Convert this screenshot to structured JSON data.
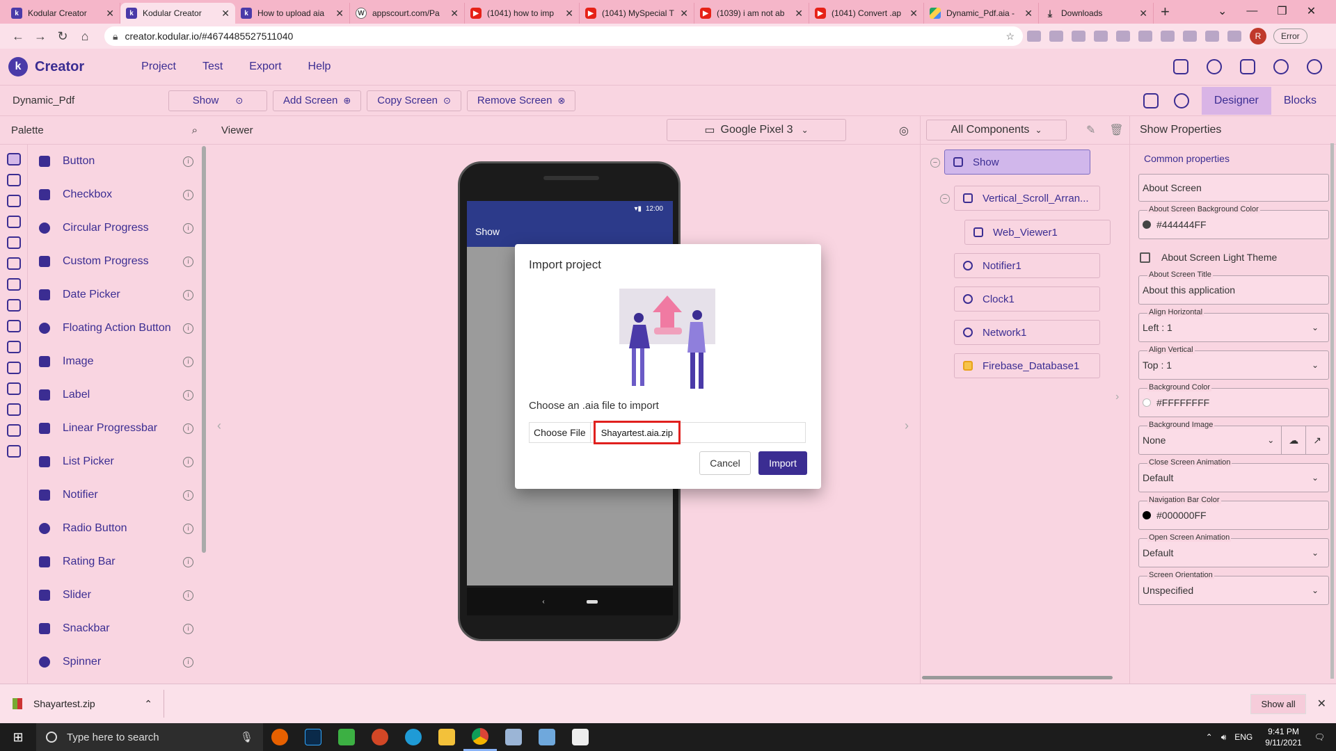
{
  "browser": {
    "tabs": [
      {
        "title": "Kodular Creator",
        "icon": "kodular-icon",
        "active": false
      },
      {
        "title": "Kodular Creator",
        "icon": "kodular-icon",
        "active": true
      },
      {
        "title": "How to upload aia",
        "icon": "kodular-icon",
        "active": false
      },
      {
        "title": "appscourt.com/Pa",
        "icon": "wordpress-icon",
        "active": false
      },
      {
        "title": "(1041) how to imp",
        "icon": "youtube-icon",
        "active": false
      },
      {
        "title": "(1041) MySpecial T",
        "icon": "youtube-icon",
        "active": false
      },
      {
        "title": "(1039) i am not ab",
        "icon": "youtube-icon",
        "active": false
      },
      {
        "title": "(1041) Convert .ap",
        "icon": "youtube-icon",
        "active": false
      },
      {
        "title": "Dynamic_Pdf.aia -",
        "icon": "drive-icon",
        "active": false
      },
      {
        "title": "Downloads",
        "icon": "download-icon",
        "active": false
      }
    ],
    "url": "creator.kodular.io/#4674485527511040",
    "profile_initial": "R",
    "error_label": "Error"
  },
  "app": {
    "name": "Creator",
    "logo_letter": "k",
    "menu": [
      "Project",
      "Test",
      "Export",
      "Help"
    ]
  },
  "toolbar": {
    "project_name": "Dynamic_Pdf",
    "screen_select": "Show",
    "add_screen": "Add Screen",
    "copy_screen": "Copy Screen",
    "remove_screen": "Remove Screen",
    "designer": "Designer",
    "blocks": "Blocks"
  },
  "palette": {
    "title": "Palette",
    "items": [
      "Button",
      "Checkbox",
      "Circular Progress",
      "Custom Progress",
      "Date Picker",
      "Floating Action Button",
      "Image",
      "Label",
      "Linear Progressbar",
      "List Picker",
      "Notifier",
      "Radio Button",
      "Rating Bar",
      "Slider",
      "Snackbar",
      "Spinner"
    ]
  },
  "viewer": {
    "title": "Viewer",
    "device": "Google Pixel 3",
    "status_time": "12:00",
    "screen_title": "Show"
  },
  "components": {
    "filter": "All Components",
    "tree": [
      "Show",
      "Vertical_Scroll_Arran...",
      "Web_Viewer1",
      "Notifier1",
      "Clock1",
      "Network1",
      "Firebase_Database1"
    ]
  },
  "properties": {
    "title": "Show Properties",
    "section": "Common properties",
    "about_screen": "About Screen",
    "about_bg_label": "About Screen Background Color",
    "about_bg_value": "#444444FF",
    "light_theme_label": "About Screen Light Theme",
    "about_title_label": "About Screen Title",
    "about_title_value": "About this application",
    "align_h_label": "Align Horizontal",
    "align_h_value": "Left : 1",
    "align_v_label": "Align Vertical",
    "align_v_value": "Top : 1",
    "bg_color_label": "Background Color",
    "bg_color_value": "#FFFFFFFF",
    "bg_image_label": "Background Image",
    "bg_image_value": "None",
    "close_anim_label": "Close Screen Animation",
    "close_anim_value": "Default",
    "nav_color_label": "Navigation Bar Color",
    "nav_color_value": "#000000FF",
    "open_anim_label": "Open Screen Animation",
    "open_anim_value": "Default",
    "orientation_label": "Screen Orientation",
    "orientation_value": "Unspecified"
  },
  "dialog": {
    "title": "Import project",
    "message": "Choose an .aia file to import",
    "choose_file": "Choose File",
    "file_name": "Shayartest.aia.zip",
    "cancel": "Cancel",
    "import": "Import"
  },
  "downloads": {
    "file": "Shayartest.zip",
    "show_all": "Show all"
  },
  "taskbar": {
    "search_placeholder": "Type here to search",
    "lang": "ENG",
    "time": "9:41 PM",
    "date": "9/11/2021"
  },
  "colors": {
    "accent": "#3b2d92",
    "panel_bg": "#f9d5e1",
    "highlight_border": "#e0201e"
  }
}
